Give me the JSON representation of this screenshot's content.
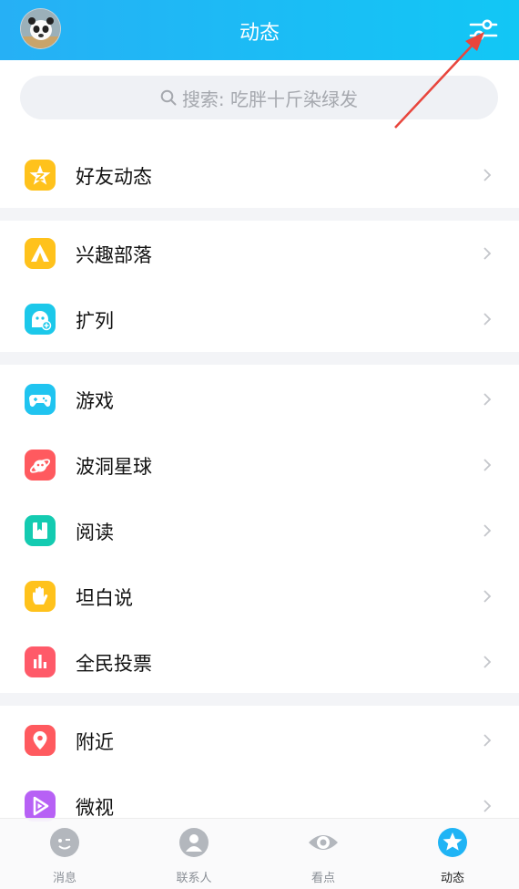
{
  "header": {
    "title": "动态"
  },
  "search": {
    "placeholder": "搜索: 吃胖十斤染绿发"
  },
  "groups": [
    {
      "items": [
        {
          "label": "好友动态",
          "icon": "qzone-star-icon",
          "color": "#ffc21c"
        }
      ]
    },
    {
      "items": [
        {
          "label": "兴趣部落",
          "icon": "tribe-tent-icon",
          "color": "#ffc21c"
        },
        {
          "label": "扩列",
          "icon": "expand-friends-icon",
          "color": "#1cc8ea"
        }
      ]
    },
    {
      "items": [
        {
          "label": "游戏",
          "icon": "gamepad-icon",
          "color": "#20c4f0"
        },
        {
          "label": "波洞星球",
          "icon": "bodong-planet-icon",
          "color": "#ff5a5f"
        },
        {
          "label": "阅读",
          "icon": "book-icon",
          "color": "#14cbb1"
        },
        {
          "label": "坦白说",
          "icon": "hand-icon",
          "color": "#ffc21c"
        },
        {
          "label": "全民投票",
          "icon": "bar-chart-icon",
          "color": "#ff5a69"
        }
      ]
    },
    {
      "items": [
        {
          "label": "附近",
          "icon": "location-pin-icon",
          "color": "#ff5a5f"
        },
        {
          "label": "微视",
          "icon": "weishi-play-icon",
          "color": "#b761f5"
        }
      ]
    }
  ],
  "tabs": [
    {
      "label": "消息",
      "icon": "message-icon",
      "active": false
    },
    {
      "label": "联系人",
      "icon": "contacts-icon",
      "active": false
    },
    {
      "label": "看点",
      "icon": "eye-icon",
      "active": false
    },
    {
      "label": "动态",
      "icon": "dynamic-icon",
      "active": true
    }
  ],
  "colors": {
    "header_start": "#26b0f5",
    "header_end": "#12c7f5",
    "annotation_arrow": "#e8453c"
  }
}
